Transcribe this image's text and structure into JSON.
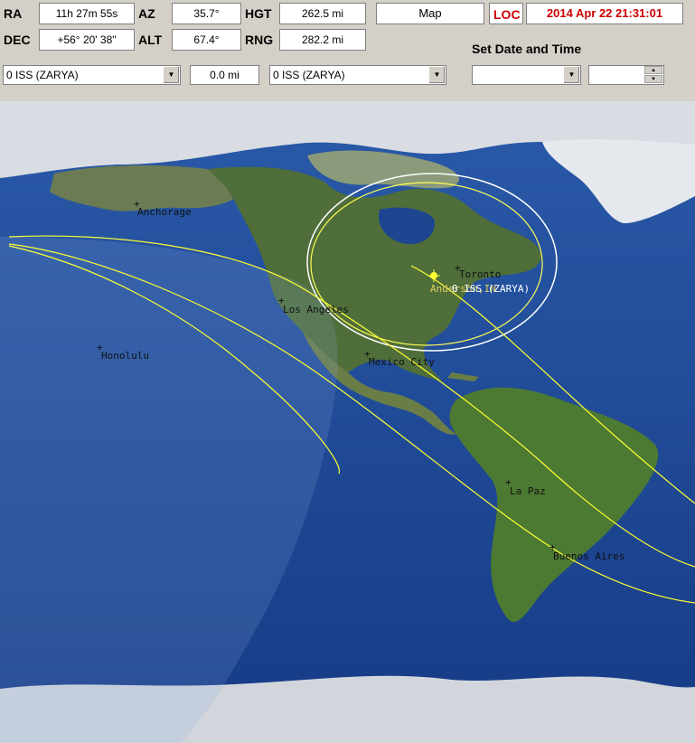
{
  "readouts": {
    "ra_label": "RA",
    "ra_value": "11h 27m 55s",
    "az_label": "AZ",
    "az_value": "35.7°",
    "hgt_label": "HGT",
    "hgt_value": "262.5 mi",
    "dec_label": "DEC",
    "dec_value": "+56° 20' 38\"",
    "alt_label": "ALT",
    "alt_value": "67.4°",
    "rng_label": "RNG",
    "rng_value": "282.2 mi"
  },
  "map_button": "Map",
  "loc_label": "LOC",
  "datetime": "2014 Apr 22   21:31:01",
  "set_datetime_label": "Set  Date and Time",
  "satellite_select_1": "0 ISS (ZARYA)",
  "distance_value": "0.0 mi",
  "satellite_select_2": "0 ISS (ZARYA)",
  "date_select_value": "",
  "time_spin_value": "",
  "map": {
    "cities": [
      "Anchorage",
      "Toronto",
      "Los Angeles",
      "Honolulu",
      "Mexico City",
      "La Paz",
      "Buenos Aires"
    ],
    "satellite_label": "0 ISS (ZARYA)",
    "observer_label": "Anderson,IN"
  },
  "colors": {
    "orbit": "#ffff33",
    "footprint": "#ffffff",
    "loc_text": "#cc0000",
    "ocean": "#1a3d8a"
  }
}
